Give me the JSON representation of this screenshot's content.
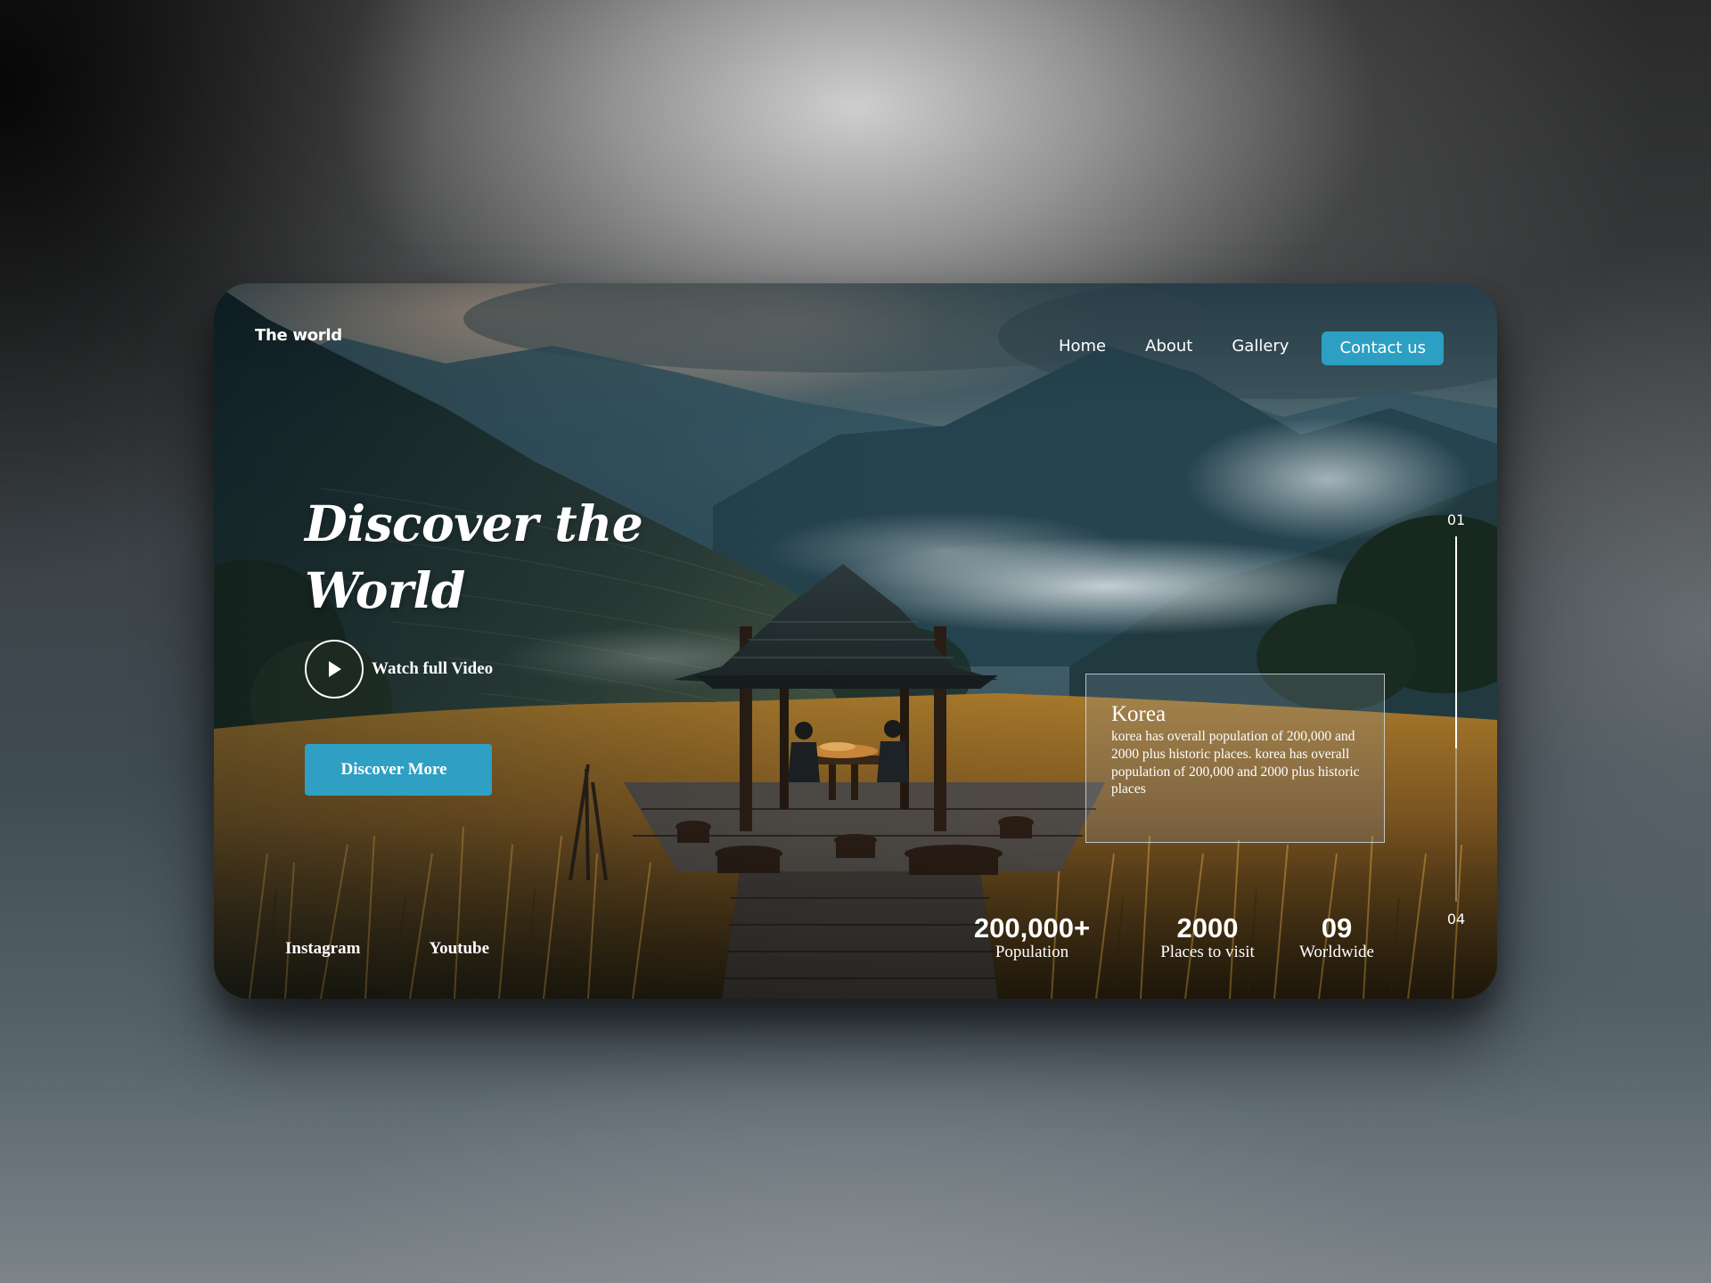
{
  "brand": {
    "name": "The world"
  },
  "nav": {
    "links": [
      "Home",
      "About",
      "Gallery"
    ],
    "contact_label": "Contact us"
  },
  "hero": {
    "title_line1": "Discover the",
    "title_line2": "World",
    "watch_label": "Watch full Video",
    "discover_label": "Discover More"
  },
  "info_card": {
    "title": "Korea",
    "text": "korea has overall population of 200,000 and 2000 plus historic places. korea has overall population of 200,000 and 2000 plus historic places"
  },
  "slider": {
    "start": "01",
    "end": "04",
    "progress": 0.58
  },
  "socials": [
    "Instagram",
    "Youtube"
  ],
  "stats": [
    {
      "value": "200,000+",
      "label": "Population"
    },
    {
      "value": "2000",
      "label": "Places to visit"
    },
    {
      "value": "09",
      "label": "Worldwide"
    }
  ],
  "colors": {
    "accent": "#2f9fc3",
    "text": "#ffffff"
  },
  "icons": {
    "play": "play-icon"
  }
}
